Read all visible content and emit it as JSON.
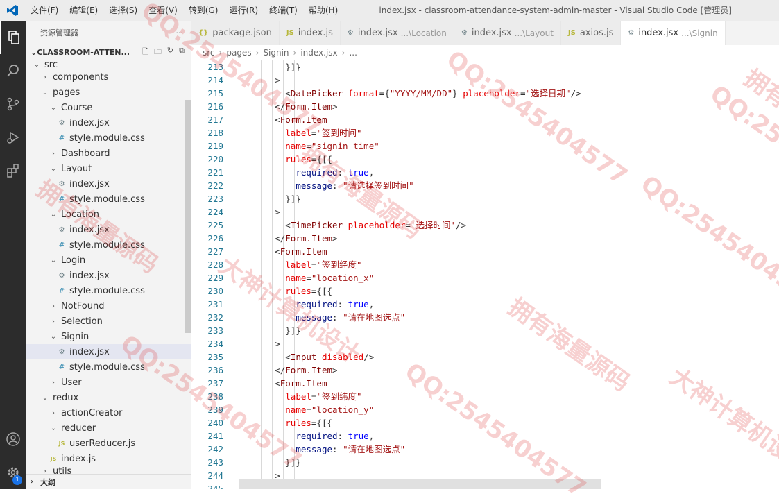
{
  "titlebar": {
    "menu": [
      "文件(F)",
      "编辑(E)",
      "选择(S)",
      "查看(V)",
      "转到(G)",
      "运行(R)",
      "终端(T)",
      "帮助(H)"
    ],
    "window_title": "index.jsx - classroom-attendance-system-admin-master - Visual Studio Code [管理员]"
  },
  "activity": {
    "badge": "1"
  },
  "sidebar": {
    "header": "资源管理器",
    "more": "···",
    "section": "CLASSROOM-ATTEN...",
    "outline": "大纲",
    "tree": [
      {
        "label": "src",
        "depth": 0,
        "kind": "folder-open",
        "cut": true
      },
      {
        "label": "components",
        "depth": 1,
        "kind": "folder"
      },
      {
        "label": "pages",
        "depth": 1,
        "kind": "folder-open"
      },
      {
        "label": "Course",
        "depth": 2,
        "kind": "folder-open"
      },
      {
        "label": "index.jsx",
        "depth": 3,
        "kind": "jsx"
      },
      {
        "label": "style.module.css",
        "depth": 3,
        "kind": "css"
      },
      {
        "label": "Dashboard",
        "depth": 2,
        "kind": "folder"
      },
      {
        "label": "Layout",
        "depth": 2,
        "kind": "folder-open"
      },
      {
        "label": "index.jsx",
        "depth": 3,
        "kind": "jsx"
      },
      {
        "label": "style.module.css",
        "depth": 3,
        "kind": "css"
      },
      {
        "label": "Location",
        "depth": 2,
        "kind": "folder-open"
      },
      {
        "label": "index.jsx",
        "depth": 3,
        "kind": "jsx"
      },
      {
        "label": "style.module.css",
        "depth": 3,
        "kind": "css"
      },
      {
        "label": "Login",
        "depth": 2,
        "kind": "folder-open"
      },
      {
        "label": "index.jsx",
        "depth": 3,
        "kind": "jsx"
      },
      {
        "label": "style.module.css",
        "depth": 3,
        "kind": "css"
      },
      {
        "label": "NotFound",
        "depth": 2,
        "kind": "folder"
      },
      {
        "label": "Selection",
        "depth": 2,
        "kind": "folder"
      },
      {
        "label": "Signin",
        "depth": 2,
        "kind": "folder-open"
      },
      {
        "label": "index.jsx",
        "depth": 3,
        "kind": "jsx",
        "selected": true
      },
      {
        "label": "style.module.css",
        "depth": 3,
        "kind": "css"
      },
      {
        "label": "User",
        "depth": 2,
        "kind": "folder"
      },
      {
        "label": "redux",
        "depth": 1,
        "kind": "folder-open"
      },
      {
        "label": "actionCreator",
        "depth": 2,
        "kind": "folder"
      },
      {
        "label": "reducer",
        "depth": 2,
        "kind": "folder-open"
      },
      {
        "label": "userReducer.js",
        "depth": 3,
        "kind": "js"
      },
      {
        "label": "index.js",
        "depth": 2,
        "kind": "js"
      },
      {
        "label": "utils",
        "depth": 1,
        "kind": "folder",
        "cut": true
      }
    ]
  },
  "tabs": [
    {
      "label": "package.json",
      "icon": "{}",
      "hint": ""
    },
    {
      "label": "index.js",
      "icon": "JS",
      "hint": ""
    },
    {
      "label": "index.jsx",
      "icon": "⚙",
      "hint": "...\\Location"
    },
    {
      "label": "index.jsx",
      "icon": "⚙",
      "hint": "...\\Layout"
    },
    {
      "label": "axios.js",
      "icon": "JS",
      "hint": ""
    },
    {
      "label": "index.jsx",
      "icon": "⚙",
      "hint": "...\\Signin",
      "active": true
    }
  ],
  "breadcrumb": [
    "src",
    "pages",
    "Signin",
    "index.jsx",
    "..."
  ],
  "editor": {
    "lines": [
      {
        "n": "213",
        "t": "          }]}"
      },
      {
        "n": "214",
        "t": "        >"
      },
      {
        "n": "215",
        "t": "          <DatePicker format={\"YYYY/MM/DD\"} placeholder=\"选择日期\"/>"
      },
      {
        "n": "216",
        "t": "        </Form.Item>"
      },
      {
        "n": "217",
        "t": "        <Form.Item"
      },
      {
        "n": "218",
        "t": "          label=\"签到时间\""
      },
      {
        "n": "219",
        "t": "          name=\"signin_time\""
      },
      {
        "n": "220",
        "t": "          rules={[{"
      },
      {
        "n": "221",
        "t": "            required: true,"
      },
      {
        "n": "222",
        "t": "            message: \"请选择签到时间\""
      },
      {
        "n": "223",
        "t": "          }]}"
      },
      {
        "n": "224",
        "t": "        >"
      },
      {
        "n": "225",
        "t": "          <TimePicker placeholder='选择时间'/>"
      },
      {
        "n": "226",
        "t": "        </Form.Item>"
      },
      {
        "n": "227",
        "t": "        <Form.Item"
      },
      {
        "n": "228",
        "t": "          label=\"签到经度\""
      },
      {
        "n": "229",
        "t": "          name=\"location_x\""
      },
      {
        "n": "230",
        "t": "          rules={[{"
      },
      {
        "n": "231",
        "t": "            required: true,"
      },
      {
        "n": "232",
        "t": "            message: \"请在地图选点\""
      },
      {
        "n": "233",
        "t": "          }]}"
      },
      {
        "n": "234",
        "t": "        >"
      },
      {
        "n": "235",
        "t": "          <Input disabled/>"
      },
      {
        "n": "236",
        "t": "        </Form.Item>"
      },
      {
        "n": "237",
        "t": "        <Form.Item"
      },
      {
        "n": "238",
        "t": "          label=\"签到纬度\""
      },
      {
        "n": "239",
        "t": "          name=\"location_y\""
      },
      {
        "n": "240",
        "t": "          rules={[{"
      },
      {
        "n": "241",
        "t": "            required: true,"
      },
      {
        "n": "242",
        "t": "            message: \"请在地图选点\""
      },
      {
        "n": "243",
        "t": "          }]}"
      },
      {
        "n": "244",
        "t": "        >"
      },
      {
        "n": "245",
        "t": "          <Input disabled/>"
      }
    ]
  },
  "watermarks": [
    "QQ:2545404577",
    "拥有海量源码",
    "大神计算机设计"
  ]
}
